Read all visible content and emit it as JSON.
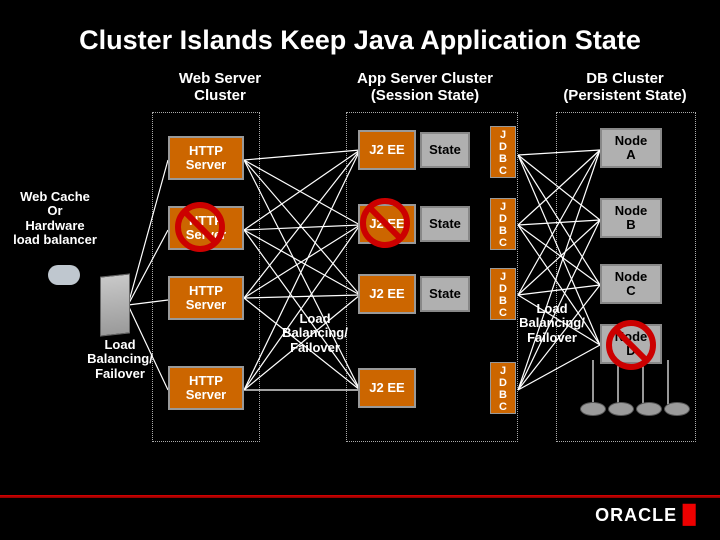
{
  "title": "Cluster Islands Keep Java Application State",
  "columns": {
    "web": "Web Server\nCluster",
    "app": "App Server Cluster\n(Session State)",
    "db": "DB Cluster\n(Persistent State)"
  },
  "left_label": "Web Cache\nOr\nHardware\nload balancer",
  "load_balance_label": "Load\nBalancing/\nFailover",
  "http_server_label": "HTTP\nServer",
  "j2ee_label": "J2 EE",
  "state_label": "State",
  "jdbc_label": "J\nD\nB\nC",
  "nodes": {
    "a": "Node\nA",
    "b": "Node\nB",
    "c": "Node\nC",
    "d": "Node\nD"
  },
  "brand": "ORACLE"
}
